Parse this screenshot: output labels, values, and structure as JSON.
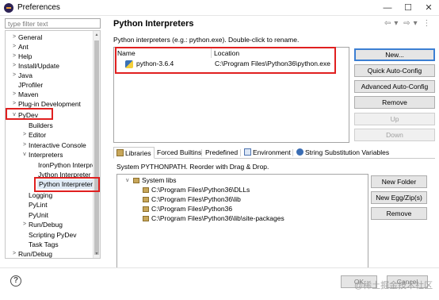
{
  "window": {
    "title": "Preferences",
    "minimize": "—",
    "maximize": "☐",
    "close": "✕"
  },
  "sidebar": {
    "filter_placeholder": "type filter text",
    "items": [
      {
        "label": "General",
        "twisty": ">"
      },
      {
        "label": "Ant",
        "twisty": ">"
      },
      {
        "label": "Help",
        "twisty": ">"
      },
      {
        "label": "Install/Update",
        "twisty": ">"
      },
      {
        "label": "Java",
        "twisty": ">"
      },
      {
        "label": "JProfiler",
        "twisty": ""
      },
      {
        "label": "Maven",
        "twisty": ">"
      },
      {
        "label": "Plug-in Development",
        "twisty": ">"
      },
      {
        "label": "PyDev",
        "twisty": "v"
      },
      {
        "label": "Builders",
        "twisty": ""
      },
      {
        "label": "Editor",
        "twisty": ">"
      },
      {
        "label": "Interactive Console",
        "twisty": ">"
      },
      {
        "label": "Interpreters",
        "twisty": "v"
      },
      {
        "label": "IronPython Interpreter",
        "twisty": ""
      },
      {
        "label": "Jython Interpreter",
        "twisty": ""
      },
      {
        "label": "Python Interpreter",
        "twisty": ""
      },
      {
        "label": "Logging",
        "twisty": ""
      },
      {
        "label": "PyLint",
        "twisty": ""
      },
      {
        "label": "PyUnit",
        "twisty": ""
      },
      {
        "label": "Run/Debug",
        "twisty": ">"
      },
      {
        "label": "Scripting PyDev",
        "twisty": ""
      },
      {
        "label": "Task Tags",
        "twisty": ""
      },
      {
        "label": "Run/Debug",
        "twisty": ">"
      }
    ]
  },
  "main": {
    "title": "Python Interpreters",
    "nav": {
      "back": "⇦",
      "back_menu": "▾",
      "forward": "⇨",
      "forward_menu": "▾",
      "more": "⋮"
    },
    "hint": "Python interpreters (e.g.: python.exe).   Double-click to rename.",
    "table": {
      "headers": [
        "Name",
        "Location"
      ],
      "rows": [
        {
          "name": "python-3.6.4",
          "location": "C:\\Program Files\\Python36\\python.exe"
        }
      ]
    },
    "buttons": {
      "new": "New...",
      "quick_auto": "Quick Auto-Config",
      "advanced_auto": "Advanced Auto-Config",
      "remove": "Remove",
      "up": "Up",
      "down": "Down"
    },
    "tabs": [
      "Libraries",
      "Forced Builtins",
      "Predefined",
      "Environment",
      "String Substitution Variables"
    ],
    "libraries": {
      "caption": "System PYTHONPATH.   Reorder with Drag & Drop.",
      "root": "System libs",
      "paths": [
        "C:\\Program Files\\Python36\\DLLs",
        "C:\\Program Files\\Python36\\lib",
        "C:\\Program Files\\Python36",
        "C:\\Program Files\\Python36\\lib\\site-packages"
      ],
      "buttons": {
        "new_folder": "New Folder",
        "new_egg": "New Egg/Zip(s)",
        "remove": "Remove"
      }
    }
  },
  "footer": {
    "help": "?",
    "watermark": "@稀土掘金技术社区",
    "ok": "OK",
    "cancel": "Cancel"
  },
  "colors": {
    "highlight": "#e02020",
    "selection": "#e1ebf6",
    "primary_border": "#3c7fd3"
  }
}
